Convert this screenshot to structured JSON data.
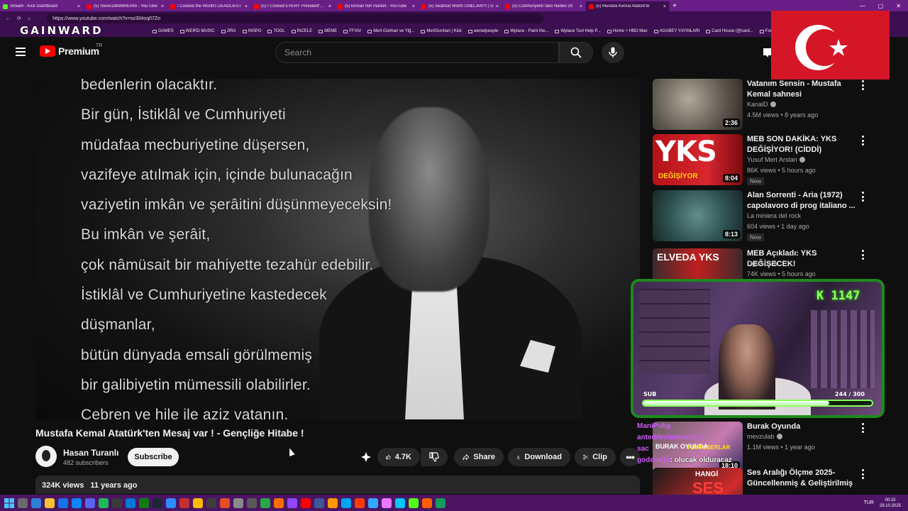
{
  "browser": {
    "tabs": [
      {
        "label": "Stream - Kick Dashboard",
        "fav": "kick"
      },
      {
        "label": "(5) Steve1989MREInfo - YouTube",
        "fav": "yt"
      },
      {
        "label": "I Cooked the World's DEADLIEST",
        "fav": "yt"
      },
      {
        "label": "(5) I Cooked EVERY President's Fa",
        "fav": "yt"
      },
      {
        "label": "(5) korean fish market - YouTube",
        "fav": "yt"
      },
      {
        "label": "(5) Seafood Worth US$1,400?! | G",
        "fav": "yt"
      },
      {
        "label": "(5) Cumhuriyetin İlanı Neden 29",
        "fav": "yt"
      },
      {
        "label": "(5) Mustafa Kemal Atatürk'te",
        "fav": "yt",
        "active": true
      }
    ],
    "new_tab": "+",
    "url": "https://www.youtube.com/watch?v=oz3Il4oq07Zo",
    "bookmarks": [
      "GAMES",
      "WEIRD MUSIC",
      "JIRA",
      "INSPO",
      "TOOL",
      "İNCELE",
      "MEME",
      "FFXIV",
      "Mert Günhan ve Yiğ...",
      "MertGunhan | Kick",
      "weredpeople",
      "Wplace - Paint the...",
      "Wplace Tool Help P...",
      "Home + HBO Max",
      "AGABEY YAYINLARI",
      "Card House (@card...",
      "Fort"
    ],
    "overlay_logo": "GAINWARD"
  },
  "youtube": {
    "brand": "Premium",
    "country": "TR",
    "search_placeholder": "Search"
  },
  "video": {
    "subtitles": [
      "bedenlerin olacaktır.",
      "Bir gün, İstiklâl ve Cumhuriyeti",
      "müdafaa mecburiyetine düşersen,",
      "vazifeye atılmak için, içinde bulunacağın",
      "vaziyetin imkân ve şerâitini düşünmeyeceksin!",
      "Bu imkân ve şerâit,",
      "çok nâmüsait bir mahiyette tezahür edebilir.",
      "İstiklâl ve Cumhuriyetine kastedecek",
      "düşmanlar,",
      "bütün dünyada emsali görülmemiş",
      "bir galibiyetin mümessili olabilirler.",
      "Cebren ve hile ile aziz vatanın,"
    ],
    "title": "Mustafa Kemal Atatürk'ten Mesaj var ! - Gençliğe Hitabe !",
    "channel": "Hasan Turanlı",
    "subscribers": "482 subscribers",
    "subscribe_label": "Subscribe",
    "likes": "4.7K",
    "share_label": "Share",
    "download_label": "Download",
    "clip_label": "Clip",
    "views": "324K views",
    "age": "11 years ago"
  },
  "recommendations": [
    {
      "title": "Vatanım Sensin - Mustafa Kemal sahnesi",
      "channel": "KanalD",
      "verified": true,
      "meta": "4.5M views • 8 years ago",
      "duration": "2:36",
      "is_new": false
    },
    {
      "title": "MEB SON DAKİKA: YKS DEĞİŞİYOR! (CİDDİ)",
      "channel": "Yusuf Mert Arslan",
      "verified": true,
      "meta": "86K views • 5 hours ago",
      "duration": "8:04",
      "is_new": true
    },
    {
      "title": "Alan Sorrenti - Aria (1972) capolavoro di prog italiano ...",
      "channel": "La miniera del rock",
      "verified": false,
      "meta": "604 views • 1 day ago",
      "duration": "8:13",
      "is_new": true
    },
    {
      "title": "MEB Açıkladı: YKS DEĞİŞECEK!",
      "channel": "Oğuz Usta",
      "verified": false,
      "meta": "74K views • 5 hours ago",
      "duration": "",
      "is_new": false
    },
    {
      "title": "Burak Oyunda",
      "channel": "mevzulab",
      "verified": true,
      "meta": "1.1M views • 1 year ago",
      "duration": "18:10",
      "is_new": false
    },
    {
      "title": "Ses Aralığı Ölçme 2025- Güncellenmiş & Geliştirilmiş ...",
      "channel": "",
      "verified": false,
      "meta": "",
      "duration": "",
      "is_new": false
    }
  ],
  "new_badge": "New",
  "thumb_texts": {
    "yks": "YKS",
    "yks_sub": "DEĞİŞİYOR",
    "elveda": "ELVEDA YKS",
    "burak": "BURAK OYUNDA",
    "youtuberlar": "YOUTUBERLAR",
    "hangi": "HANGİ",
    "ses": "SES"
  },
  "stream": {
    "counter": "K 1147",
    "sub_label": "SUB",
    "sub_goal": "244 / 300",
    "sub_progress": 0.8133,
    "chat": [
      {
        "user": "ManiPubg",
        "text": ""
      },
      {
        "user": "antedilevlanmadim",
        "text": ""
      },
      {
        "user": "sac",
        "text": ""
      },
      {
        "user": "godene14",
        "text": ": olucak olduracaz"
      }
    ]
  },
  "taskbar": {
    "clock_time": "00:15",
    "clock_date": "29.10.2025",
    "lang": "TUR"
  }
}
